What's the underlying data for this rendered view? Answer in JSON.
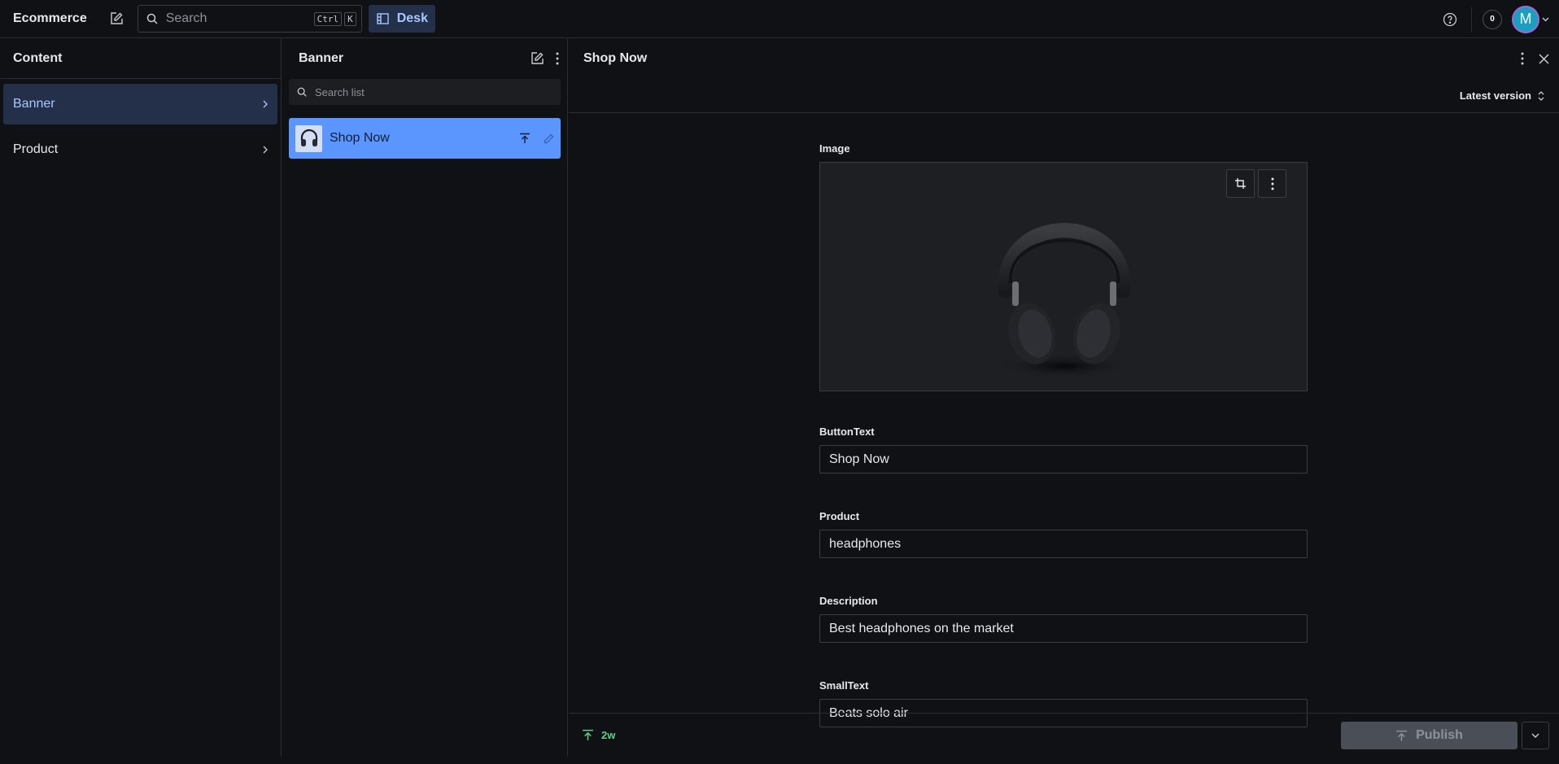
{
  "topbar": {
    "brand": "Ecommerce",
    "search_placeholder": "Search",
    "shortcut_keys": [
      "Ctrl",
      "K"
    ],
    "desk_label": "Desk",
    "notification_count": "0",
    "avatar_initial": "M"
  },
  "content_pane": {
    "title": "Content",
    "items": [
      {
        "label": "Banner"
      },
      {
        "label": "Product"
      }
    ]
  },
  "list_pane": {
    "title": "Banner",
    "search_placeholder": "Search list",
    "documents": [
      {
        "title": "Shop Now"
      }
    ]
  },
  "document_pane": {
    "title": "Shop Now",
    "version_label": "Latest version",
    "fields": {
      "image_label": "Image",
      "button_text_label": "ButtonText",
      "button_text_value": "Shop Now",
      "product_label": "Product",
      "product_value": "headphones",
      "description_label": "Description",
      "description_value": "Best headphones on the market",
      "small_text_label": "SmallText",
      "small_text_value": "Beats solo air"
    },
    "footer": {
      "published_ago": "2w",
      "publish_label": "Publish"
    }
  },
  "colors": {
    "background": "#101114",
    "accent": "#5b96ff",
    "active_nav_bg": "#243049",
    "published_status": "#5fd08b"
  }
}
